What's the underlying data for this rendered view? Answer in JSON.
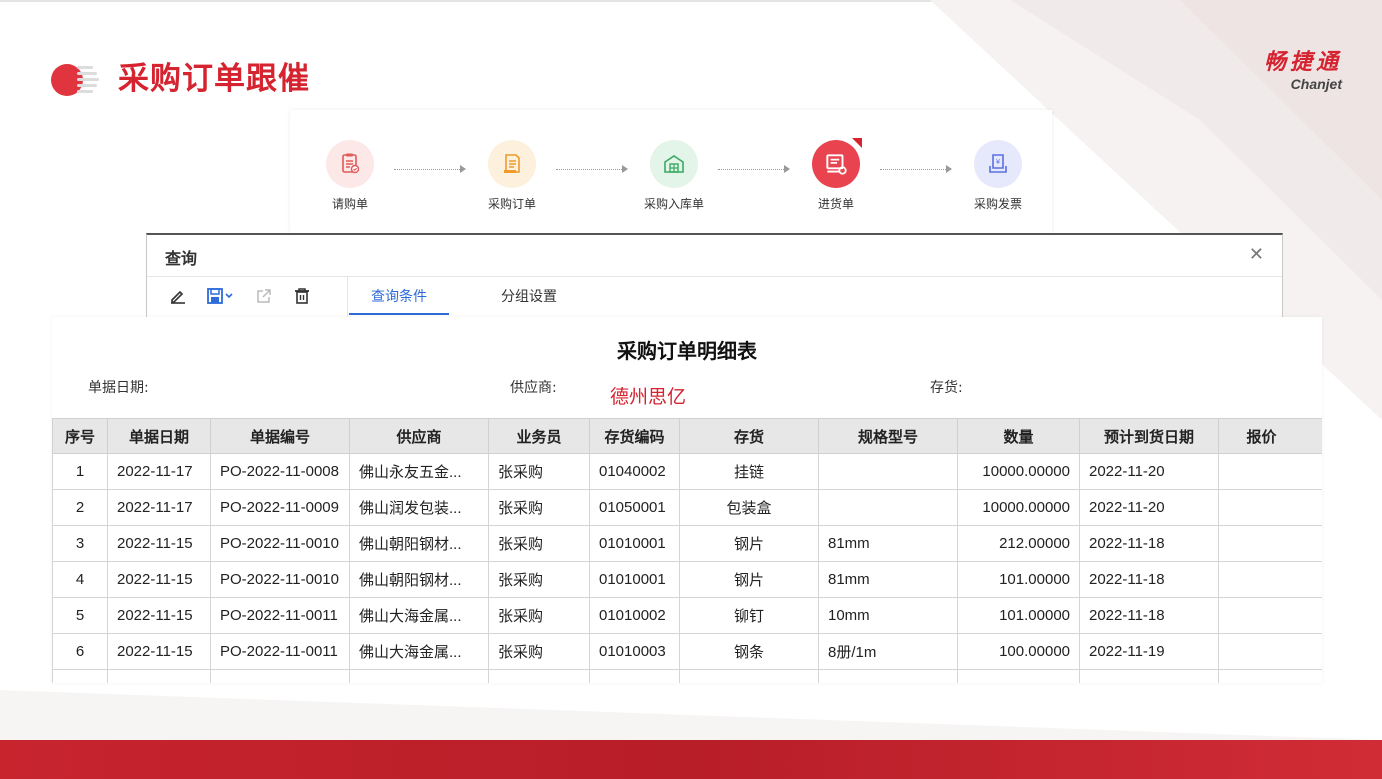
{
  "page": {
    "title": "采购订单跟催",
    "brand_cn": "畅捷通",
    "brand_en": "Chanjet"
  },
  "flow": {
    "steps": [
      {
        "label": "请购单",
        "icon": "clipboard-check-icon",
        "bg": "#fde8e8",
        "color": "#e05a5a"
      },
      {
        "label": "采购订单",
        "icon": "order-document-icon",
        "bg": "#fdf0dc",
        "color": "#ef9a2b"
      },
      {
        "label": "采购入库单",
        "icon": "warehouse-icon",
        "bg": "#e3f4e8",
        "color": "#3aaa63"
      },
      {
        "label": "进货单",
        "icon": "stock-in-icon",
        "bg": "#e8434f",
        "color": "#ffffff",
        "active": true
      },
      {
        "label": "采购发票",
        "icon": "invoice-icon",
        "bg": "#e6e9fb",
        "color": "#5b6fe0"
      }
    ]
  },
  "query": {
    "title": "查询",
    "tabs": [
      "查询条件",
      "分组设置"
    ]
  },
  "report": {
    "title": "采购订单明细表",
    "filters": {
      "date_label": "单据日期:",
      "supplier_label": "供应商:",
      "supplier_value": "德州思亿",
      "stock_label": "存货:"
    },
    "columns": [
      "序号",
      "单据日期",
      "单据编号",
      "供应商",
      "业务员",
      "存货编码",
      "存货",
      "规格型号",
      "数量",
      "预计到货日期",
      "报价"
    ],
    "rows": [
      [
        "1",
        "2022-11-17",
        "PO-2022-11-0008",
        "佛山永友五金...",
        "张采购",
        "01040002",
        "挂链",
        "",
        "10000.00000",
        "2022-11-20",
        ""
      ],
      [
        "2",
        "2022-11-17",
        "PO-2022-11-0009",
        "佛山润发包装...",
        "张采购",
        "01050001",
        "包装盒",
        "",
        "10000.00000",
        "2022-11-20",
        ""
      ],
      [
        "3",
        "2022-11-15",
        "PO-2022-11-0010",
        "佛山朝阳钢材...",
        "张采购",
        "01010001",
        "钢片",
        "81mm",
        "212.00000",
        "2022-11-18",
        ""
      ],
      [
        "4",
        "2022-11-15",
        "PO-2022-11-0010",
        "佛山朝阳钢材...",
        "张采购",
        "01010001",
        "钢片",
        "81mm",
        "101.00000",
        "2022-11-18",
        ""
      ],
      [
        "5",
        "2022-11-15",
        "PO-2022-11-0011",
        "佛山大海金属...",
        "张采购",
        "01010002",
        "铆钉",
        "10mm",
        "101.00000",
        "2022-11-18",
        ""
      ],
      [
        "6",
        "2022-11-15",
        "PO-2022-11-0011",
        "佛山大海金属...",
        "张采购",
        "01010003",
        "钢条",
        "8册/1m",
        "100.00000",
        "2022-11-19",
        ""
      ],
      [
        "",
        "",
        "",
        "",
        "",
        "",
        "",
        "",
        "",
        "",
        ""
      ]
    ]
  },
  "colors": {
    "accent": "#d5232f",
    "link": "#2a36a0",
    "tab_active": "#2d6cd8"
  }
}
